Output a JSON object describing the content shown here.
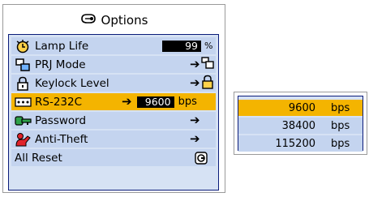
{
  "menu": {
    "title": "Options",
    "items": [
      {
        "label": "Lamp Life",
        "value": "99",
        "unit": "%"
      },
      {
        "label": "PRJ Mode"
      },
      {
        "label": "Keylock Level"
      },
      {
        "label": "RS-232C",
        "value": "9600",
        "unit": "bps"
      },
      {
        "label": "Password"
      },
      {
        "label": "Anti-Theft"
      },
      {
        "label": "All Reset"
      }
    ]
  },
  "submenu": {
    "options": [
      {
        "value": "9600",
        "unit": "bps"
      },
      {
        "value": "38400",
        "unit": "bps"
      },
      {
        "value": "115200",
        "unit": "bps"
      }
    ],
    "selected_index": 0
  },
  "colors": {
    "selected": "#f4b400",
    "row": "#c4d4ef",
    "panel": "#d6e2f4",
    "border": "#0b1c7a"
  },
  "icons": [
    "options-icon",
    "lamp-timer-icon",
    "projection-mode-icon",
    "lock-icon",
    "serial-port-icon",
    "key-icon",
    "anti-theft-icon",
    "reset-button-icon",
    "arrow-right-icon"
  ]
}
